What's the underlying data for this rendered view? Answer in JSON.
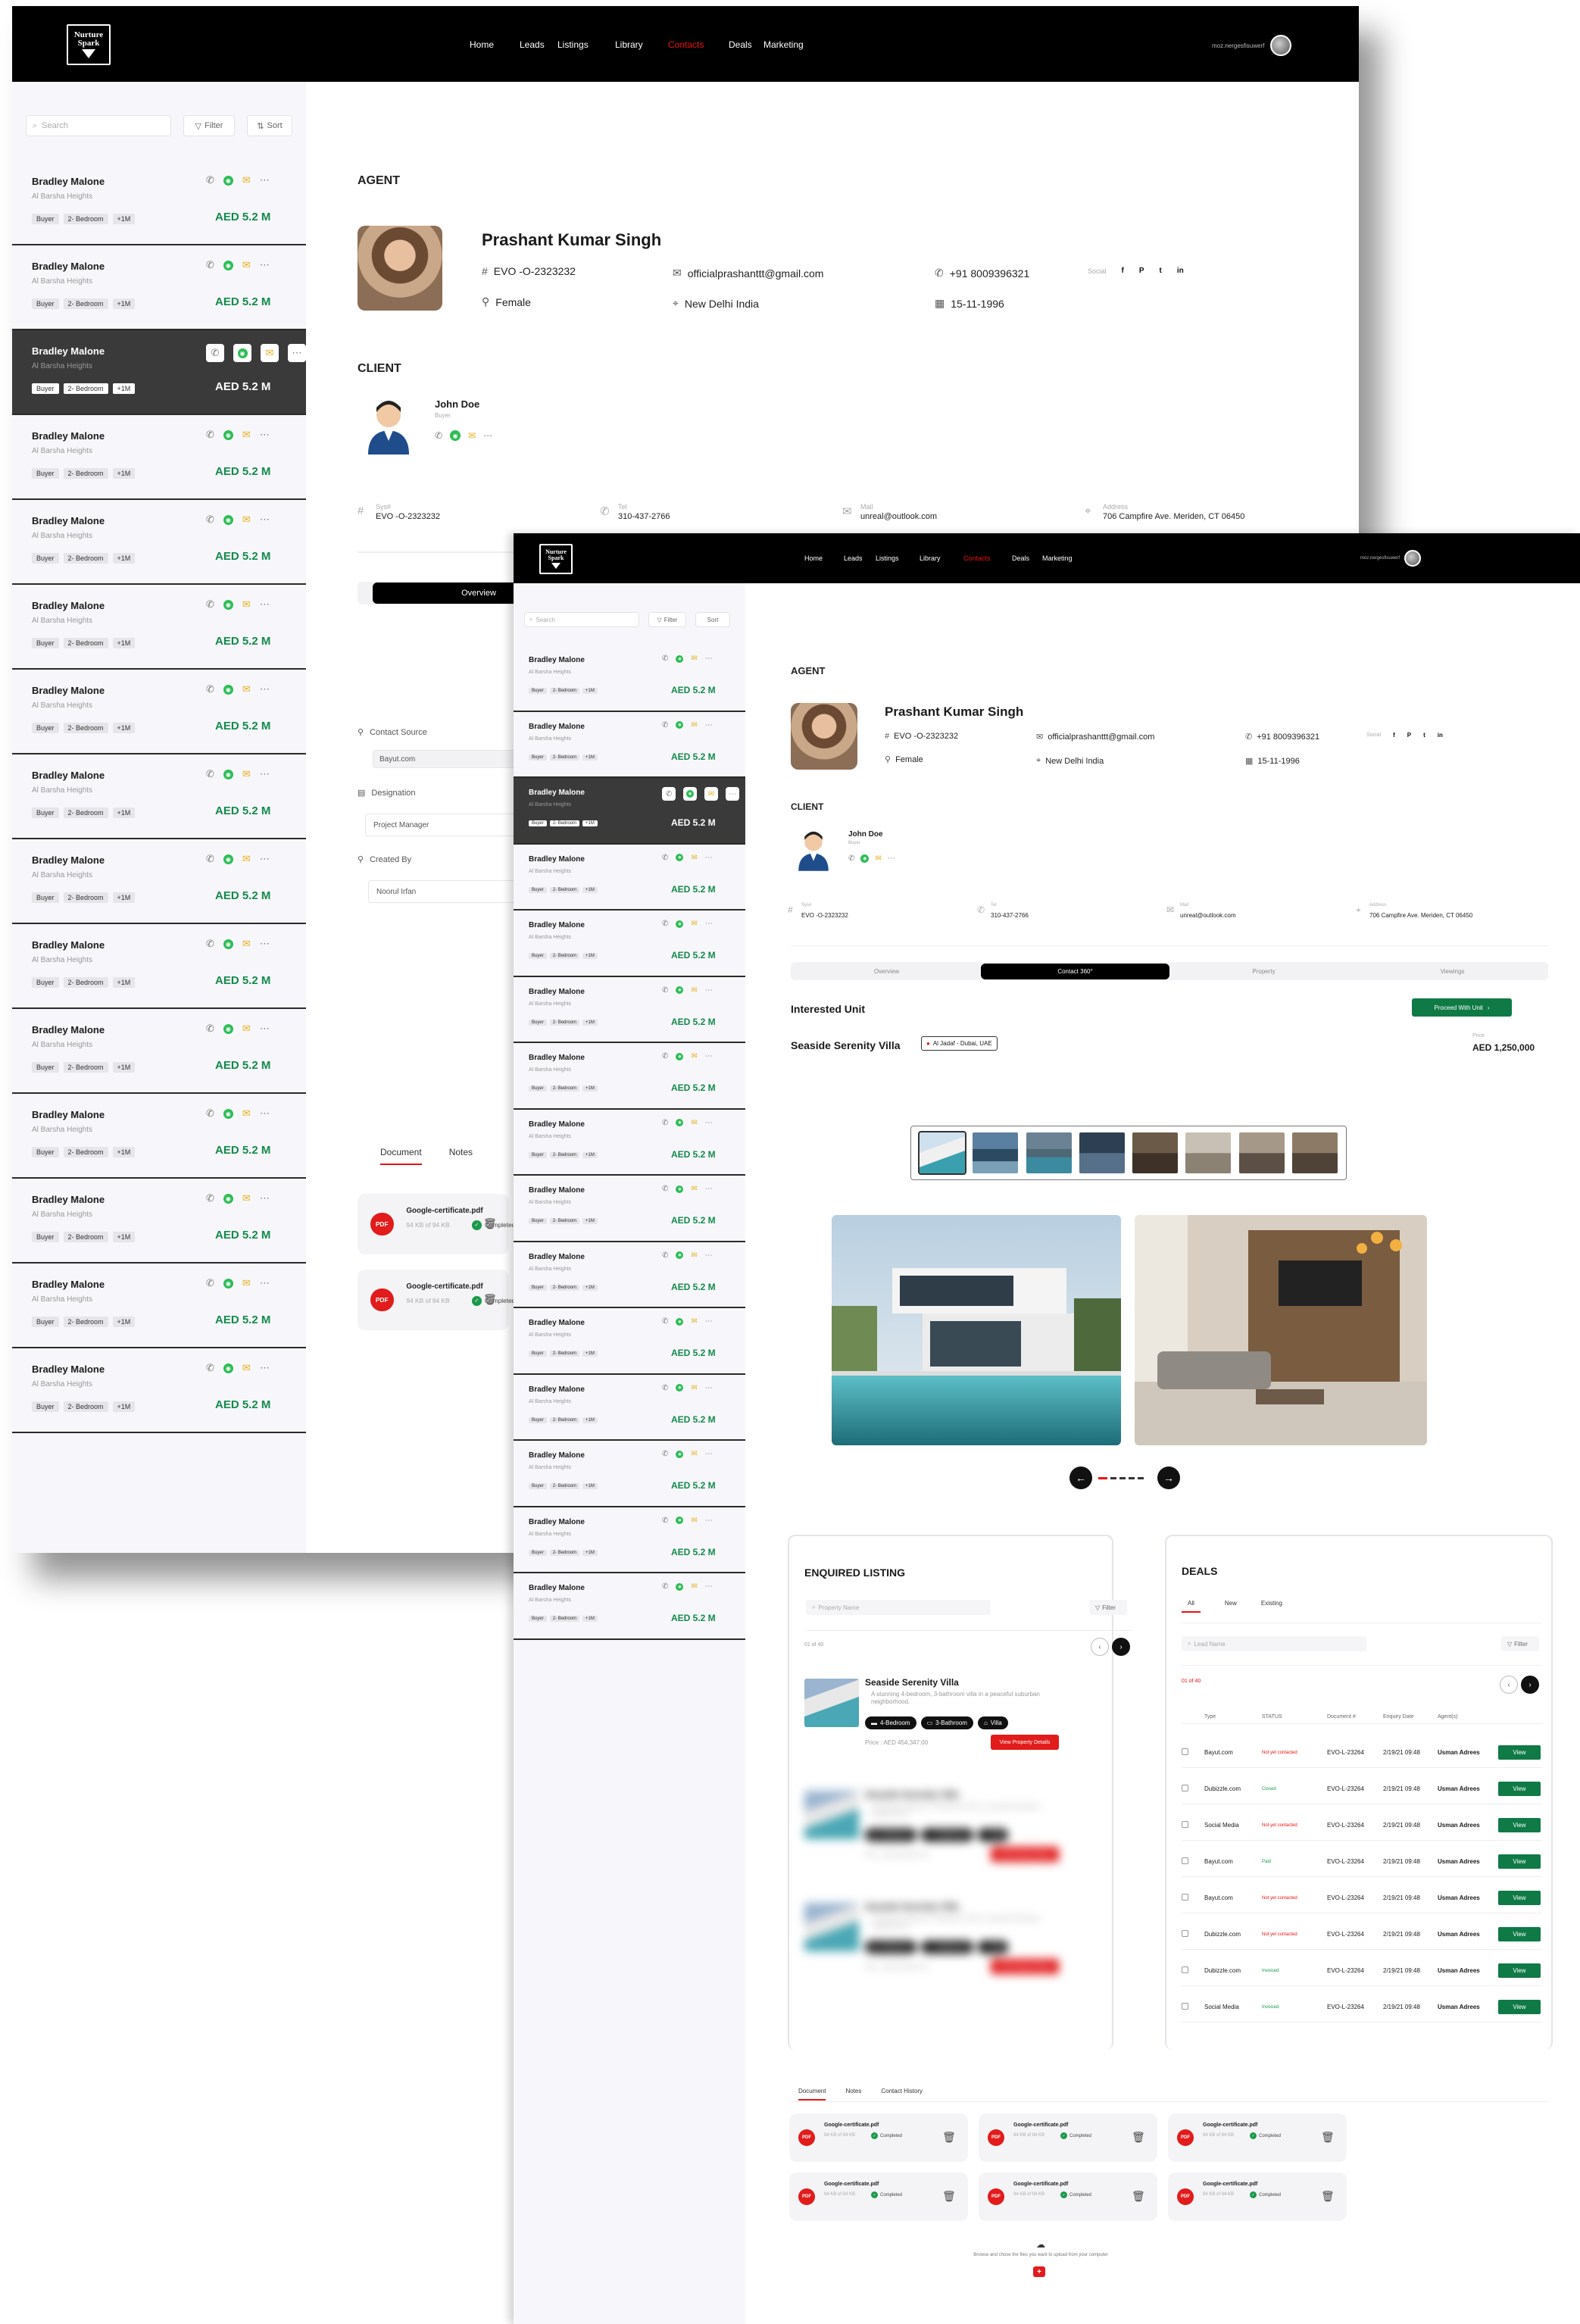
{
  "brand": {
    "logo_line1": "Nurture",
    "logo_line2": "Spark"
  },
  "nav": {
    "links": [
      "Home",
      "Leads",
      "Listings",
      "Library",
      "Contacts",
      "Deals",
      "Marketing"
    ],
    "active": "Contacts",
    "user_name": "moz.nergesfisuwerf"
  },
  "sidebar": {
    "search_placeholder": "Search",
    "filter_label": "Filter",
    "sort_label": "Sort",
    "card": {
      "name": "Bradley Malone",
      "location": "Al Barsha Heights",
      "tags": [
        "Buyer",
        "2- Bedroom",
        "+1M"
      ],
      "price": "AED 5.2 M"
    }
  },
  "agent": {
    "heading": "AGENT",
    "name": "Prashant Kumar Singh",
    "id": "EVO -O-2323232",
    "email": "officialprashanttt@gmail.com",
    "phone": "+91 8009396321",
    "gender": "Female",
    "address": "New Delhi India",
    "dob": "15-11-1996",
    "social_label": "Social",
    "social_icons": [
      "f",
      "P",
      "t",
      "in"
    ]
  },
  "client": {
    "heading": "CLIENT",
    "name": "John Doe",
    "role": "Buyer",
    "fields": [
      {
        "label": "Sys#",
        "value": "EVO -O-2323232"
      },
      {
        "label": "Tel",
        "value": "310-437-2766"
      },
      {
        "label": "Mail",
        "value": "unreal@outlook.com"
      },
      {
        "label": "Address",
        "value": "706 Campfire Ave. Meriden, CT 06450"
      }
    ]
  },
  "tabs": {
    "items": [
      "Overview",
      "Contact 360°",
      "Property",
      "Viewings"
    ],
    "active": "Contact 360°"
  },
  "overview_form": {
    "contact_source_label": "Contact Source",
    "contact_source_value": "Bayut.com",
    "designation_label": "Designation",
    "designation_value": "Project Manager",
    "created_by_label": "Created By",
    "created_by_value": "Noorul Irfan"
  },
  "interested": {
    "title": "Interested Unit",
    "proceed_label": "Proceed With Unit",
    "property_name": "Seaside Serenity Villa",
    "location_badge": "Al Jadaf - Dubai, UAE",
    "price_label": "Price",
    "price_value": "AED 1,250,000"
  },
  "enquired": {
    "title": "ENQUIRED LISTING",
    "search_placeholder": "Property Name",
    "filter_label": "Filter",
    "count": "01 of 40",
    "item": {
      "name": "Seaside Serenity Villa",
      "desc": "A stunning 4-bedroom, 3-bathroom villa in a peaceful suburban neighborhood.",
      "pills": [
        "4-Bedroom",
        "3-Bathroom",
        "Villa"
      ],
      "price": "Price : AED 454,347.00",
      "button": "View Property Details"
    }
  },
  "deals": {
    "title": "DEALS",
    "tabs": [
      "All",
      "New",
      "Existing"
    ],
    "search_placeholder": "Lead Name",
    "filter_label": "Filter",
    "count": "01 of 40",
    "columns": [
      "Type",
      "STATUS",
      "Document #",
      "Enquiry Date",
      "Agent(s)"
    ],
    "rows": [
      {
        "type": "Bayut.com",
        "status": "Not yet contacted",
        "status_color": "red",
        "doc": "EVO-L-23264",
        "date": "2/19/21 09:48",
        "agent": "Usman Adrees",
        "action": "View"
      },
      {
        "type": "Dubizzle.com",
        "status": "Closed",
        "status_color": "green",
        "doc": "EVO-L-23264",
        "date": "2/19/21 09:48",
        "agent": "Usman Adrees",
        "action": "View"
      },
      {
        "type": "Social Media",
        "status": "Not yet contacted",
        "status_color": "red",
        "doc": "EVO-L-23264",
        "date": "2/19/21 09:48",
        "agent": "Usman Adrees",
        "action": "View"
      },
      {
        "type": "Bayut.com",
        "status": "Paid",
        "status_color": "green",
        "doc": "EVO-L-23264",
        "date": "2/19/21 09:48",
        "agent": "Usman Adrees",
        "action": "View"
      },
      {
        "type": "Bayut.com",
        "status": "Not yet contacted",
        "status_color": "red",
        "doc": "EVO-L-23264",
        "date": "2/19/21 09:48",
        "agent": "Usman Adrees",
        "action": "View"
      },
      {
        "type": "Dubizzle.com",
        "status": "Not yet contacted",
        "status_color": "red",
        "doc": "EVO-L-23264",
        "date": "2/19/21 09:48",
        "agent": "Usman Adrees",
        "action": "View"
      },
      {
        "type": "Dubizzle.com",
        "status": "Invoiced",
        "status_color": "green",
        "doc": "EVO-L-23264",
        "date": "2/19/21 09:48",
        "agent": "Usman Adrees",
        "action": "View"
      },
      {
        "type": "Social Media",
        "status": "Invoiced",
        "status_color": "green",
        "doc": "EVO-L-23264",
        "date": "2/19/21 09:48",
        "agent": "Usman Adrees",
        "action": "View"
      }
    ]
  },
  "documents": {
    "tabs": [
      "Document",
      "Notes",
      "Contact History"
    ],
    "file_name": "Google-certificate.pdf",
    "file_size": "94 KB of 94 KB",
    "status": "Completed",
    "pdf_label": "PDF",
    "upload_text": "Browse and chose the files you want to upload from your computer",
    "upload_button": "+"
  },
  "colors": {
    "accent_red": "#e11111",
    "green": "#0f7a46",
    "price_green": "#138a4a",
    "dark": "#000000"
  }
}
